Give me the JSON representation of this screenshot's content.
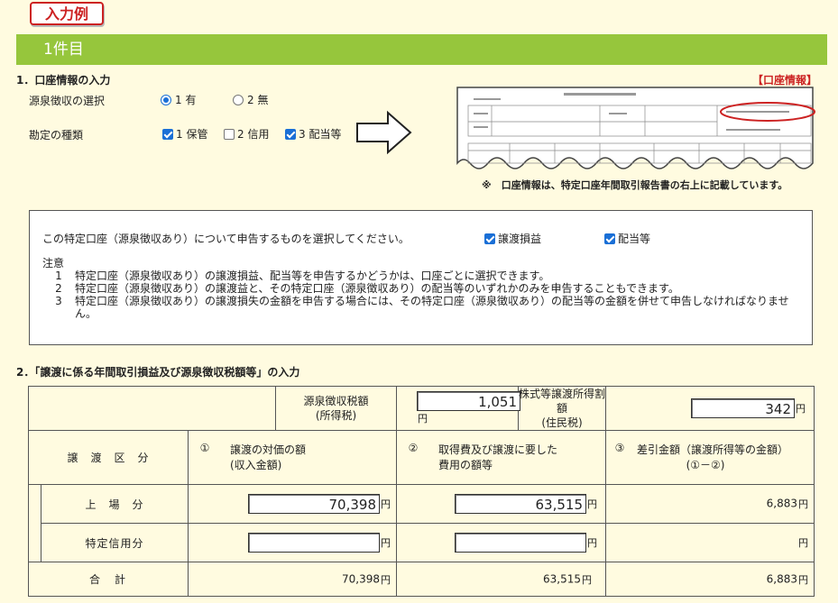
{
  "badge": "入力例",
  "item_title": "1件目",
  "section1": {
    "title": "1．口座情報の入力",
    "account_info_label": "【口座情報】",
    "withholding_label": "源泉徴収の選択",
    "withholding_options": [
      "1 有",
      "2 無"
    ],
    "withholding_selected": "1 有",
    "account_type_label": "勘定の種類",
    "account_types": [
      {
        "label": "1 保管",
        "checked": true
      },
      {
        "label": "2 信用",
        "checked": false
      },
      {
        "label": "3 配当等",
        "checked": true
      }
    ],
    "note": "※　口座情報は、特定口座年間取引報告書の右上に記載しています。"
  },
  "notice": {
    "question": "この特定口座（源泉徴収あり）について申告するものを選択してください。",
    "choices": [
      {
        "label": "譲渡損益",
        "checked": true
      },
      {
        "label": "配当等",
        "checked": true
      }
    ],
    "notes_title": "注意",
    "notes": [
      {
        "num": "1",
        "text": "特定口座（源泉徴収あり）の譲渡損益、配当等を申告するかどうかは、口座ごとに選択できます。"
      },
      {
        "num": "2",
        "text": "特定口座（源泉徴収あり）の譲渡益と、その特定口座（源泉徴収あり）の配当等のいずれかのみを申告することもできます。"
      },
      {
        "num": "3",
        "text": "特定口座（源泉徴収あり）の譲渡損失の金額を申告する場合には、その特定口座（源泉徴収あり）の配当等の金額を併せて申告しなければなりません。"
      }
    ]
  },
  "section2": {
    "title": "2．「譲渡に係る年間取引損益及び源泉徴収税額等」の入力",
    "withholding_tax_label_1": "源泉徴収税額",
    "withholding_tax_label_2": "(所得税)",
    "withholding_tax_value": "1,051",
    "local_tax_label_1": "株式等譲渡所得割額",
    "local_tax_label_2": "(住民税)",
    "local_tax_value": "342",
    "unit": "円",
    "category_header": "譲　渡　区　分",
    "col1_num": "①",
    "col1_line1": "譲渡の対価の額",
    "col1_line2": "(収入金額)",
    "col2_num": "②",
    "col2_line1": "取得費及び譲渡に要した",
    "col2_line2": "費用の額等",
    "col3_num": "③",
    "col3_line1": "差引金額（譲渡所得等の金額）",
    "col3_line2": "(①－②)",
    "rows": [
      {
        "label": "上　場　分",
        "proceeds": "70,398",
        "cost": "63,515",
        "diff": "6,883"
      },
      {
        "label": "特定信用分",
        "proceeds": "",
        "cost": "",
        "diff": ""
      }
    ],
    "total": {
      "label": "合　計",
      "proceeds": "70,398",
      "cost": "63,515",
      "diff": "6,883"
    }
  },
  "colors": {
    "accent_green": "#96c63c",
    "badge_red": "#cc2222",
    "check_blue": "#1a6fd6",
    "background": "#fffbe0"
  }
}
